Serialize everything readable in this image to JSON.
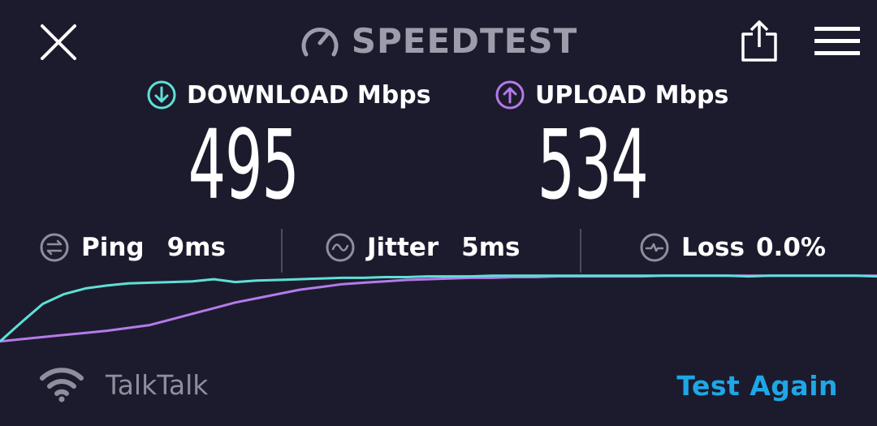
{
  "header": {
    "title": "SPEEDTEST",
    "close_icon": "close-icon",
    "logo_icon": "speedometer-icon",
    "share_icon": "share-icon",
    "menu_icon": "hamburger-menu-icon"
  },
  "download": {
    "label": "DOWNLOAD Mbps",
    "value": "495",
    "color": "#5fe0d6"
  },
  "upload": {
    "label": "UPLOAD Mbps",
    "value": "534",
    "color": "#b57ae8"
  },
  "stats": {
    "ping": {
      "label": "Ping",
      "value": "9ms"
    },
    "jitter": {
      "label": "Jitter",
      "value": "5ms"
    },
    "loss": {
      "label": "Loss",
      "value": "0.0%"
    }
  },
  "chart_data": {
    "type": "line",
    "series": [
      {
        "color": "#5fe0d6",
        "values": [
          0.05,
          0.32,
          0.58,
          0.72,
          0.8,
          0.84,
          0.87,
          0.88,
          0.89,
          0.9,
          0.93,
          0.89,
          0.91,
          0.92,
          0.93,
          0.94,
          0.95,
          0.95,
          0.96,
          0.96,
          0.97,
          0.97,
          0.97,
          0.98,
          0.98,
          0.98,
          0.98,
          0.98,
          0.98,
          0.98,
          0.98,
          0.98,
          0.98,
          0.98,
          0.98,
          0.97,
          0.98,
          0.98,
          0.98,
          0.98,
          0.98,
          0.97
        ]
      },
      {
        "color": "#b57ae8",
        "values": [
          0.05,
          0.08,
          0.11,
          0.14,
          0.17,
          0.2,
          0.24,
          0.28,
          0.36,
          0.44,
          0.52,
          0.6,
          0.66,
          0.72,
          0.78,
          0.82,
          0.86,
          0.88,
          0.9,
          0.92,
          0.93,
          0.94,
          0.95,
          0.95,
          0.96,
          0.96,
          0.97,
          0.97,
          0.97,
          0.97,
          0.97,
          0.98,
          0.98,
          0.98,
          0.98,
          0.98,
          0.98,
          0.98,
          0.98,
          0.98,
          0.98,
          0.98
        ]
      }
    ]
  },
  "footer": {
    "wifi_icon": "wifi-icon",
    "isp": "TalkTalk",
    "test_again": "Test Again",
    "accent": "#1ea7e6"
  }
}
